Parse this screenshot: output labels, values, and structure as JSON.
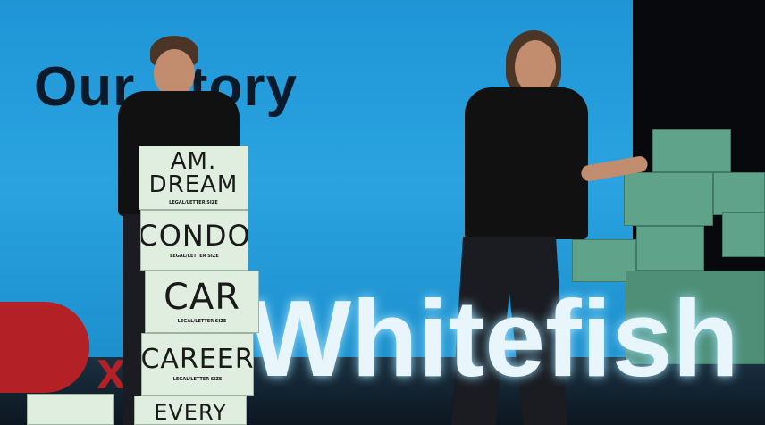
{
  "slide": {
    "title": "Our Story"
  },
  "logo": {
    "brand_letter": "D",
    "brand_x": "x",
    "word": "Whitefish"
  },
  "boxes": [
    {
      "label": "AM.\nDREAM",
      "fine_print": "LEGAL/LETTER SIZE"
    },
    {
      "label": "CONDO",
      "fine_print": "LEGAL/LETTER SIZE"
    },
    {
      "label": "CAR",
      "fine_print": "LEGAL/LETTER SIZE"
    },
    {
      "label": "CAREER",
      "fine_print": "LEGAL/LETTER SIZE"
    },
    {
      "label": "EVERY",
      "fine_print": ""
    }
  ],
  "colors": {
    "screen": "#2aa3e0",
    "tedx_red": "#b32025",
    "box": "#dfeede",
    "stage_boxes": "#5fa38a"
  }
}
